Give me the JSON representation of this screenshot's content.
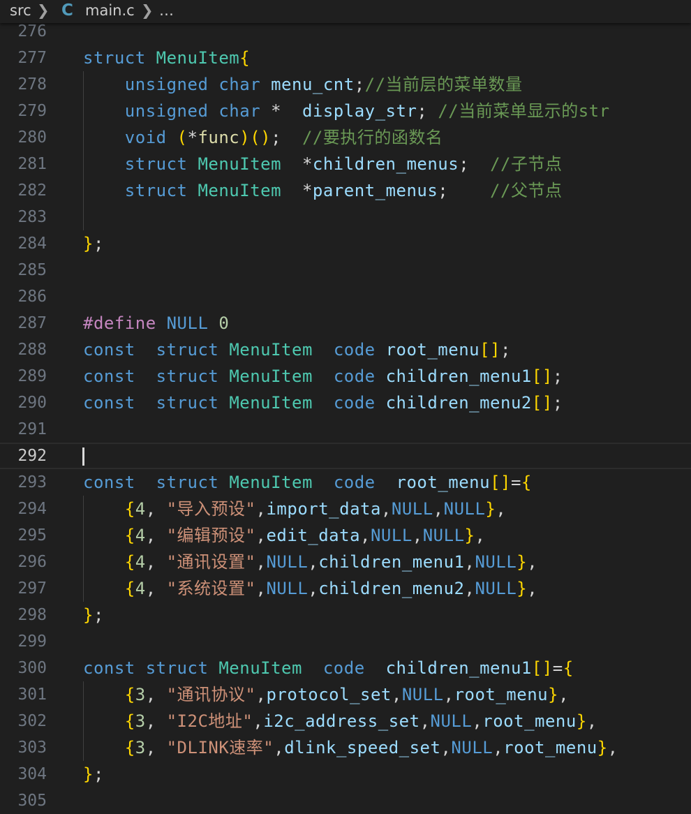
{
  "breadcrumb": {
    "folder": "src",
    "file_icon": "C",
    "file": "main.c",
    "more": "…"
  },
  "colors": {
    "background": "#1f1f1f",
    "keyword": "#569cd6",
    "type_name": "#4ec9b0",
    "identifier": "#9cdcfe",
    "function": "#dcdcaa",
    "string": "#ce9178",
    "number": "#b5cea8",
    "comment": "#6a9955",
    "preprocessor": "#c586c0",
    "punct": "#d4d4d4",
    "bracket_gold": "#ffd700",
    "bracket_pink": "#da70d6",
    "bracket_blue": "#179fff",
    "line_number": "#6e7681"
  },
  "editor": {
    "current_line": 292,
    "lines": [
      {
        "n": "276",
        "code": ""
      },
      {
        "n": "277",
        "code": "struct MenuItem{"
      },
      {
        "n": "278",
        "code": "    unsigned char menu_cnt;//当前层的菜单数量"
      },
      {
        "n": "279",
        "code": "    unsigned char *  display_str; //当前菜单显示的str"
      },
      {
        "n": "280",
        "code": "    void (*func)();  //要执行的函数名"
      },
      {
        "n": "281",
        "code": "    struct MenuItem  *children_menus;  //子节点"
      },
      {
        "n": "282",
        "code": "    struct MenuItem  *parent_menus;    //父节点"
      },
      {
        "n": "283",
        "code": ""
      },
      {
        "n": "284",
        "code": "};"
      },
      {
        "n": "285",
        "code": ""
      },
      {
        "n": "286",
        "code": ""
      },
      {
        "n": "287",
        "code": "#define NULL 0"
      },
      {
        "n": "288",
        "code": "const  struct MenuItem  code root_menu[];"
      },
      {
        "n": "289",
        "code": "const  struct MenuItem  code children_menu1[];"
      },
      {
        "n": "290",
        "code": "const  struct MenuItem  code children_menu2[];"
      },
      {
        "n": "291",
        "code": ""
      },
      {
        "n": "292",
        "code": ""
      },
      {
        "n": "293",
        "code": "const  struct MenuItem  code  root_menu[]={"
      },
      {
        "n": "294",
        "code": "    {4, \"导入预设\",import_data,NULL,NULL},"
      },
      {
        "n": "295",
        "code": "    {4, \"编辑预设\",edit_data,NULL,NULL},"
      },
      {
        "n": "296",
        "code": "    {4, \"通讯设置\",NULL,children_menu1,NULL},"
      },
      {
        "n": "297",
        "code": "    {4, \"系统设置\",NULL,children_menu2,NULL},"
      },
      {
        "n": "298",
        "code": "};"
      },
      {
        "n": "299",
        "code": ""
      },
      {
        "n": "300",
        "code": "const struct MenuItem  code  children_menu1[]={"
      },
      {
        "n": "301",
        "code": "    {3, \"通讯协议\",protocol_set,NULL,root_menu},"
      },
      {
        "n": "302",
        "code": "    {3, \"I2C地址\",i2c_address_set,NULL,root_menu},"
      },
      {
        "n": "303",
        "code": "    {3, \"DLINK速率\",dlink_speed_set,NULL,root_menu},"
      },
      {
        "n": "304",
        "code": "};"
      },
      {
        "n": "305",
        "code": ""
      }
    ]
  }
}
